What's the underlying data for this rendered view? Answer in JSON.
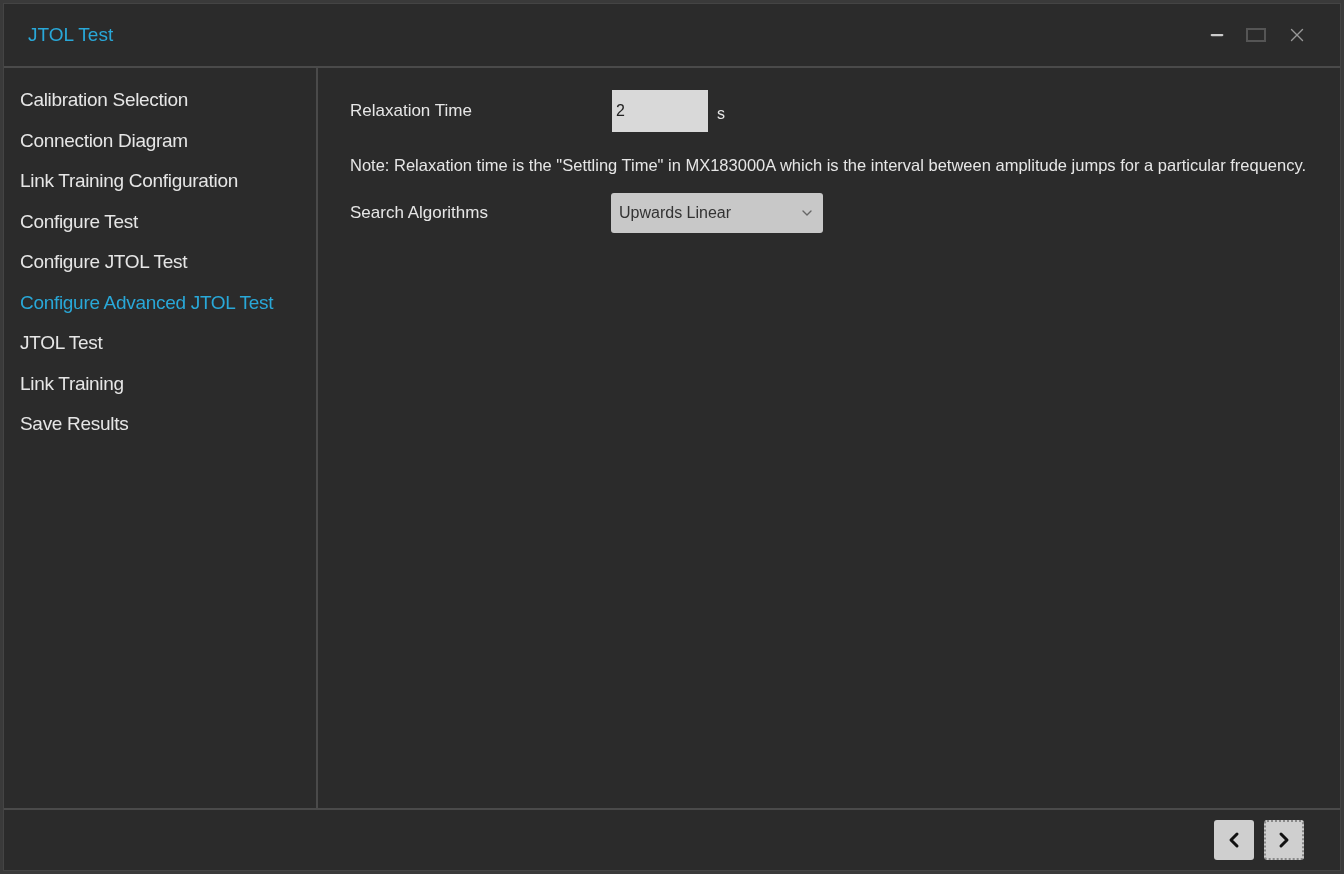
{
  "window": {
    "title": "JTOL Test"
  },
  "sidebar": {
    "items": [
      {
        "label": "Calibration Selection",
        "selected": false
      },
      {
        "label": "Connection Diagram",
        "selected": false
      },
      {
        "label": "Link Training Configuration",
        "selected": false
      },
      {
        "label": "Configure Test",
        "selected": false
      },
      {
        "label": "Configure JTOL Test",
        "selected": false
      },
      {
        "label": "Configure Advanced JTOL Test",
        "selected": true
      },
      {
        "label": "JTOL Test",
        "selected": false
      },
      {
        "label": "Link Training",
        "selected": false
      },
      {
        "label": "Save Results",
        "selected": false
      }
    ]
  },
  "relaxation": {
    "label": "Relaxation Time",
    "value": "2",
    "unit": "s"
  },
  "note": "Note: Relaxation time is the \"Settling Time\" in MX183000A which is the interval between amplitude jumps for a particular frequency.",
  "search": {
    "label": "Search Algorithms",
    "value": "Upwards Linear"
  }
}
